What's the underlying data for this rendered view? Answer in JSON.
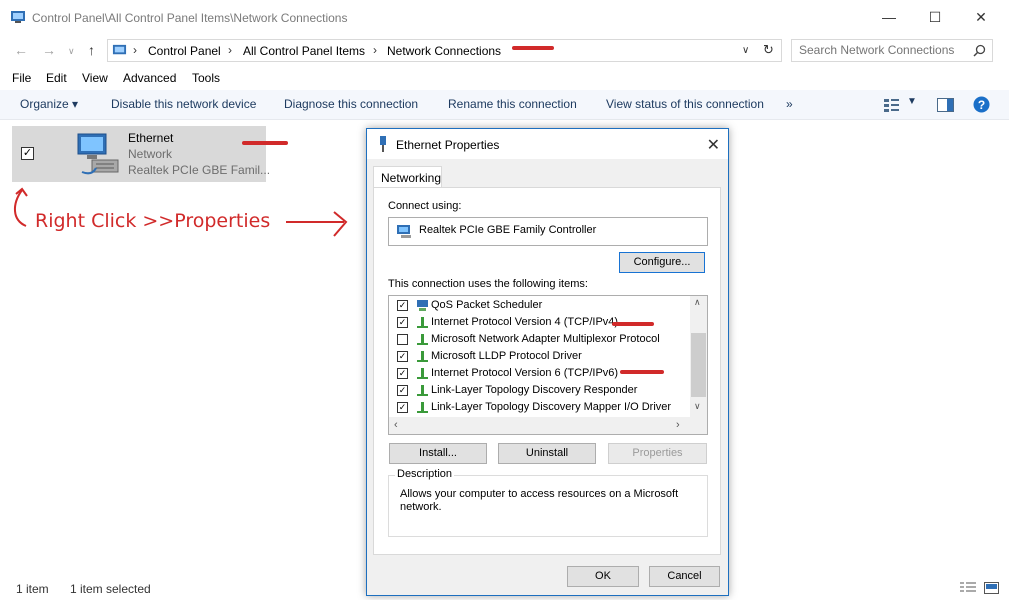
{
  "window": {
    "title": "Control Panel\\All Control Panel Items\\Network Connections"
  },
  "address": {
    "crumbs": [
      "Control Panel",
      "All Control Panel Items",
      "Network Connections"
    ]
  },
  "search": {
    "placeholder": "Search Network Connections"
  },
  "menu": [
    "File",
    "Edit",
    "View",
    "Advanced",
    "Tools"
  ],
  "toolbar": {
    "organize": "Organize ▾",
    "disable": "Disable this network device",
    "diagnose": "Diagnose this connection",
    "rename": "Rename this connection",
    "view_status": "View status of this connection",
    "more": "»"
  },
  "connection": {
    "name": "Ethernet",
    "status": "Network",
    "adapter": "Realtek PCIe GBE Famil..."
  },
  "annotation": {
    "instruction": "Right Click >>Properties",
    "color": "#d12a2a"
  },
  "statusbar": {
    "count": "1 item",
    "selected": "1 item selected"
  },
  "dialog": {
    "title": "Ethernet Properties",
    "tab": "Networking",
    "connect_using_label": "Connect using:",
    "adapter_name": "Realtek PCIe GBE Family Controller",
    "configure_label": "Configure...",
    "items_label": "This connection uses the following items:",
    "items": [
      {
        "label": "QoS Packet Scheduler",
        "checked": true
      },
      {
        "label": "Internet Protocol Version 4 (TCP/IPv4)",
        "checked": true
      },
      {
        "label": "Microsoft Network Adapter Multiplexor Protocol",
        "checked": false
      },
      {
        "label": "Microsoft LLDP Protocol Driver",
        "checked": true
      },
      {
        "label": "Internet Protocol Version 6 (TCP/IPv6)",
        "checked": true
      },
      {
        "label": "Link-Layer Topology Discovery Responder",
        "checked": true
      },
      {
        "label": "Link-Layer Topology Discovery Mapper I/O Driver",
        "checked": true
      }
    ],
    "install_label": "Install...",
    "uninstall_label": "Uninstall",
    "properties_label": "Properties",
    "description_legend": "Description",
    "description_text": "Allows your computer to access resources on a Microsoft network.",
    "ok_label": "OK",
    "cancel_label": "Cancel"
  }
}
